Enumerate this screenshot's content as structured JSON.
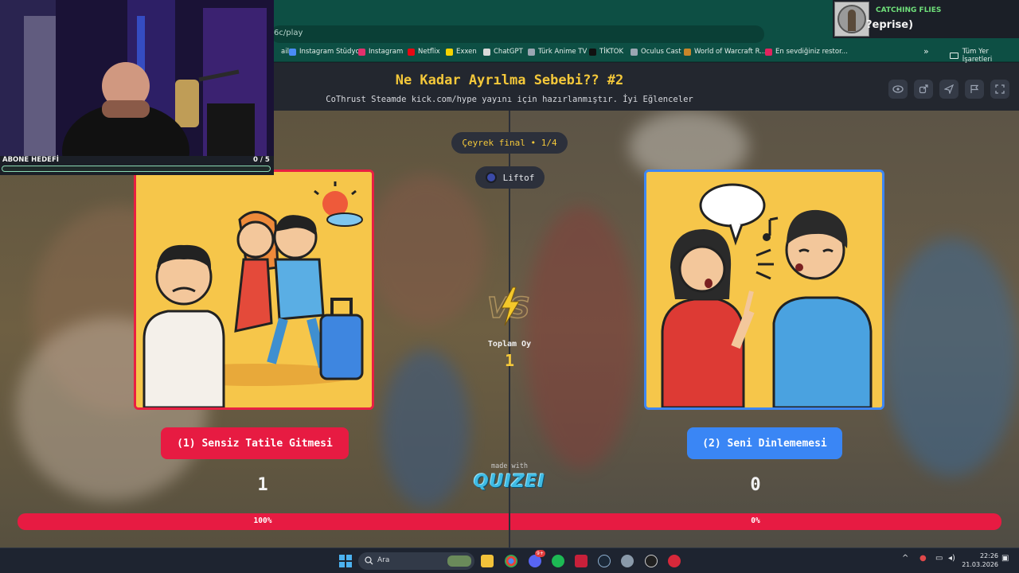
{
  "browser": {
    "url_fragment": "6c/play",
    "bookmarks": [
      {
        "label": "ail",
        "icon": "mail-icon",
        "color": "#0d4f44"
      },
      {
        "label": "Instagram Stüdyo",
        "icon": "meta-icon",
        "color": "#4a8cf7"
      },
      {
        "label": "Instagram",
        "icon": "instagram-icon",
        "color": "#e1306c"
      },
      {
        "label": "Netflix",
        "icon": "netflix-icon",
        "color": "#e50914"
      },
      {
        "label": "Exxen",
        "icon": "exxen-icon",
        "color": "#f5d300"
      },
      {
        "label": "ChatGPT",
        "icon": "chatgpt-icon",
        "color": "#d9d9d9"
      },
      {
        "label": "Türk Anime TV",
        "icon": "anime-icon",
        "color": "#9aa6b2"
      },
      {
        "label": "TİKTOK",
        "icon": "tiktok-icon",
        "color": "#111111"
      },
      {
        "label": "Oculus Cast",
        "icon": "oculus-icon",
        "color": "#9aa6b2"
      },
      {
        "label": "World of Warcraft R...",
        "icon": "wow-icon",
        "color": "#c8862a"
      },
      {
        "label": "En sevdiğiniz restor...",
        "icon": "yemeksepeti-icon",
        "color": "#e0245e"
      }
    ],
    "more": "»",
    "all_bookmarks": "Tüm Yer İşaretleri"
  },
  "quiz": {
    "title": "Ne Kadar Ayrılma Sebebi?? #2",
    "subtitle": "CoThrust Steamde kick.com/hype yayını için hazırlanmıştır. İyi Eğlenceler",
    "round": "Çeyrek final • 1/4",
    "user": "Liftof",
    "vs": "VS",
    "total_label": "Toplam Oy",
    "total_value": "1",
    "made_with": "made with",
    "brand": "QUIZEI",
    "left": {
      "label": "(1) Sensiz Tatile Gitmesi",
      "votes": "1",
      "percent_text": "100%",
      "percent": 100,
      "accent": "#e71b42"
    },
    "right": {
      "label": "(2) Seni Dinlememesi",
      "votes": "0",
      "percent_text": "0%",
      "percent": 0,
      "accent": "#3a86f5"
    },
    "tools": [
      "eye-icon",
      "share-icon",
      "send-icon",
      "flag-icon",
      "fullscreen-icon"
    ]
  },
  "overlay": {
    "goal_label": "ABONE HEDEFİ",
    "goal_count": "0  / 5",
    "goal_progress": 0,
    "now_playing_label": "CATCHING FLIES",
    "now_playing_track": "?eprise)"
  },
  "taskbar": {
    "search_placeholder": "Ara",
    "badge": "9+",
    "time": "22:26",
    "date": "21.03.2026"
  }
}
